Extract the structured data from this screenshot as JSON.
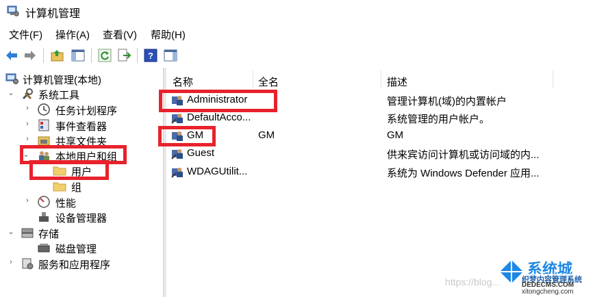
{
  "window": {
    "title": "计算机管理"
  },
  "menu": [
    "文件(F)",
    "操作(A)",
    "查看(V)",
    "帮助(H)"
  ],
  "toolbar": {
    "icons": [
      "back-icon",
      "forward-icon",
      "up-folder-icon",
      "show-hide-tree-icon",
      "refresh-icon",
      "export-list-icon",
      "help-icon",
      "show-action-pane-icon"
    ]
  },
  "tree": [
    {
      "label": "计算机管理(本地)",
      "expander": ""
    },
    {
      "label": "系统工具",
      "expander": "⌄"
    },
    {
      "label": "任务计划程序",
      "expander": "›"
    },
    {
      "label": "事件查看器",
      "expander": "›"
    },
    {
      "label": "共享文件夹",
      "expander": "›"
    },
    {
      "label": "本地用户和组",
      "expander": "⌄"
    },
    {
      "label": "用户",
      "expander": ""
    },
    {
      "label": "组",
      "expander": ""
    },
    {
      "label": "性能",
      "expander": "›"
    },
    {
      "label": "设备管理器",
      "expander": ""
    },
    {
      "label": "存储",
      "expander": "⌄"
    },
    {
      "label": "磁盘管理",
      "expander": ""
    },
    {
      "label": "服务和应用程序",
      "expander": "›"
    }
  ],
  "list": {
    "columns": [
      "名称",
      "全名",
      "描述"
    ],
    "rows": [
      {
        "name": "Administrator",
        "fullname": "",
        "desc": "管理计算机(域)的内置帐户"
      },
      {
        "name": "DefaultAcco...",
        "fullname": "",
        "desc": "系统管理的用户帐户。"
      },
      {
        "name": "GM",
        "fullname": "GM",
        "desc": "GM"
      },
      {
        "name": "Guest",
        "fullname": "",
        "desc": "供来宾访问计算机或访问域的内..."
      },
      {
        "name": "WDAGUtilit...",
        "fullname": "",
        "desc": "系统为 Windows Defender 应用..."
      }
    ]
  },
  "watermark": {
    "blog_text": "https://blog...",
    "logo_text": "系统城",
    "logo_sub1": "织梦内容管理系统",
    "logo_sub2": "DEDECMS.COM",
    "logo_sub3": "xitongcheng.com"
  },
  "colors": {
    "highlight_box": "#e8222c",
    "accent_blue": "#1e88e5"
  }
}
